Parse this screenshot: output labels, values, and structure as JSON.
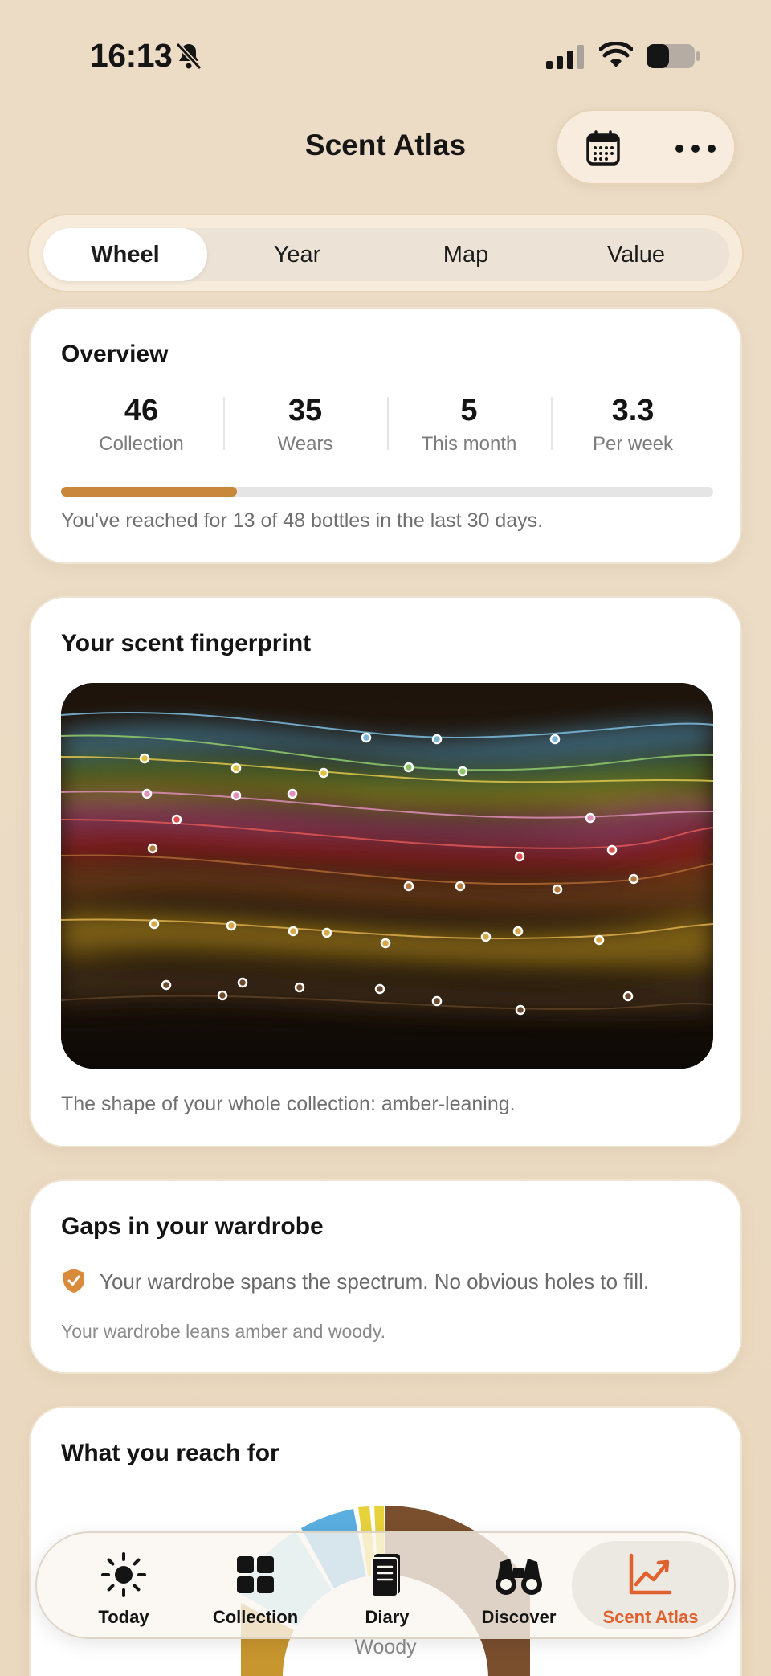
{
  "status_bar": {
    "time": "16:13"
  },
  "header": {
    "title": "Scent Atlas"
  },
  "segments": [
    {
      "label": "Wheel",
      "active": true
    },
    {
      "label": "Year",
      "active": false
    },
    {
      "label": "Map",
      "active": false
    },
    {
      "label": "Value",
      "active": false
    }
  ],
  "overview": {
    "title": "Overview",
    "stats": [
      {
        "value": "46",
        "label": "Collection"
      },
      {
        "value": "35",
        "label": "Wears"
      },
      {
        "value": "5",
        "label": "This month"
      },
      {
        "value": "3.3",
        "label": "Per week"
      }
    ],
    "progress_fraction": 0.27,
    "summary": "You've reached for 13 of 48 bottles in the last 30 days."
  },
  "fingerprint": {
    "title": "Your scent fingerprint",
    "caption": "The shape of your whole collection: amber-leaning."
  },
  "gaps": {
    "title": "Gaps in your wardrobe",
    "message": "Your wardrobe spans the spectrum. No obvious holes to fill.",
    "note": "Your wardrobe leans amber and woody."
  },
  "reach": {
    "title": "What you reach for",
    "center_label": "Woody"
  },
  "tabs": [
    {
      "label": "Today",
      "icon": "sun-icon",
      "active": false
    },
    {
      "label": "Collection",
      "icon": "grid-icon",
      "active": false
    },
    {
      "label": "Diary",
      "icon": "notebook-icon",
      "active": false
    },
    {
      "label": "Discover",
      "icon": "binoculars-icon",
      "active": false
    },
    {
      "label": "Scent Atlas",
      "icon": "chart-icon",
      "active": true
    }
  ],
  "colors": {
    "accent": "#e0612e",
    "progress": "#c9873b",
    "amber": "#c8962e",
    "woody": "#7a4f2e",
    "fresh_blue": "#5aaee0"
  }
}
